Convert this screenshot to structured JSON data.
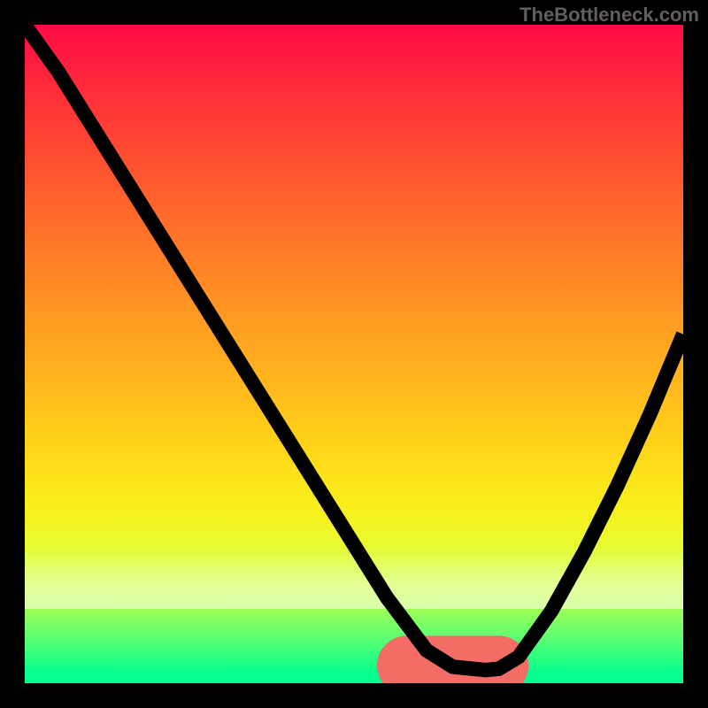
{
  "watermark": "TheBottleneck.com",
  "chart_data": {
    "type": "line",
    "title": "",
    "xlabel": "",
    "ylabel": "",
    "xlim": [
      0,
      100
    ],
    "ylim": [
      0,
      100
    ],
    "grid": false,
    "legend": null,
    "annotations": [],
    "series": [
      {
        "name": "bottleneck-curve",
        "x": [
          0,
          5,
          10,
          15,
          20,
          25,
          30,
          35,
          40,
          45,
          50,
          55,
          58,
          61,
          65,
          70,
          72,
          75,
          80,
          85,
          90,
          95,
          100
        ],
        "values": [
          100,
          93,
          85,
          77,
          69,
          61,
          53,
          45,
          37,
          29,
          21,
          13,
          9,
          5,
          2.5,
          2,
          2.2,
          4,
          11,
          20,
          30,
          41,
          53
        ]
      },
      {
        "name": "optimal-range-highlight",
        "x": [
          58,
          72
        ],
        "values": [
          2.7,
          2.7
        ]
      }
    ],
    "background_gradient": {
      "top": "#ff0b47",
      "mid": "#ffd419",
      "bottom": "#00ff92"
    }
  }
}
